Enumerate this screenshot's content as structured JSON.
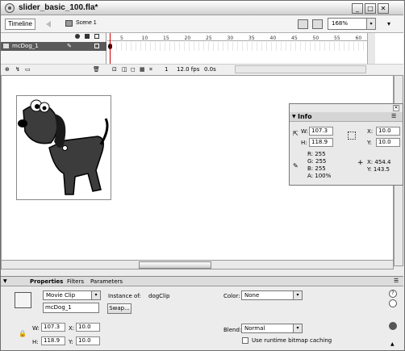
{
  "window": {
    "title": "slider_basic_100.fla*",
    "minimize": "_",
    "maximize": "□",
    "close": "✕"
  },
  "timeline_bar": {
    "timeline_label": "Timeline",
    "scene_label": "Scene 1",
    "zoom_value": "168%",
    "dropdown_glyph": "▾"
  },
  "timeline": {
    "ruler_ticks": [
      "5",
      "10",
      "15",
      "20",
      "25",
      "30",
      "35",
      "40",
      "45",
      "50",
      "55",
      "60"
    ],
    "layer_name": "mcDog_1",
    "current_frame": "1",
    "fps": "12.0 fps",
    "elapsed": "0.0s"
  },
  "info_panel": {
    "title": "Info",
    "w_label": "W:",
    "w_value": "107.3",
    "h_label": "H:",
    "h_value": "118.9",
    "x_label": "X:",
    "x_value": "10.0",
    "y_label": "Y:",
    "y_value": "10.0",
    "r": "R: 255",
    "g": "G: 255",
    "b": "B: 255",
    "a": "A: 100%",
    "cursor_x": "X: 454.4",
    "cursor_y": "Y: 143.5",
    "plus": "+"
  },
  "properties": {
    "tabs": [
      "Properties",
      "Filters",
      "Parameters"
    ],
    "symbol_type": "Movie Clip",
    "instance_name": "mcDog_1",
    "instance_of_label": "Instance of:",
    "instance_of_value": "dogClip",
    "swap_label": "Swap...",
    "color_label": "Color:",
    "color_value": "None",
    "w_label": "W:",
    "w_value": "107.3",
    "h_label": "H:",
    "h_value": "118.9",
    "x_label": "X:",
    "x_value": "10.0",
    "y_label": "Y:",
    "y_value": "10.0",
    "blend_label": "Blend:",
    "blend_value": "Normal",
    "cache_label": "Use runtime bitmap caching",
    "help_glyph": "?"
  },
  "colors": {
    "layer_selected": "#5a5a5a",
    "dog_body": "#3c3c3c",
    "dog_ear": "#1a1a1a",
    "playhead": "#cc0000"
  }
}
